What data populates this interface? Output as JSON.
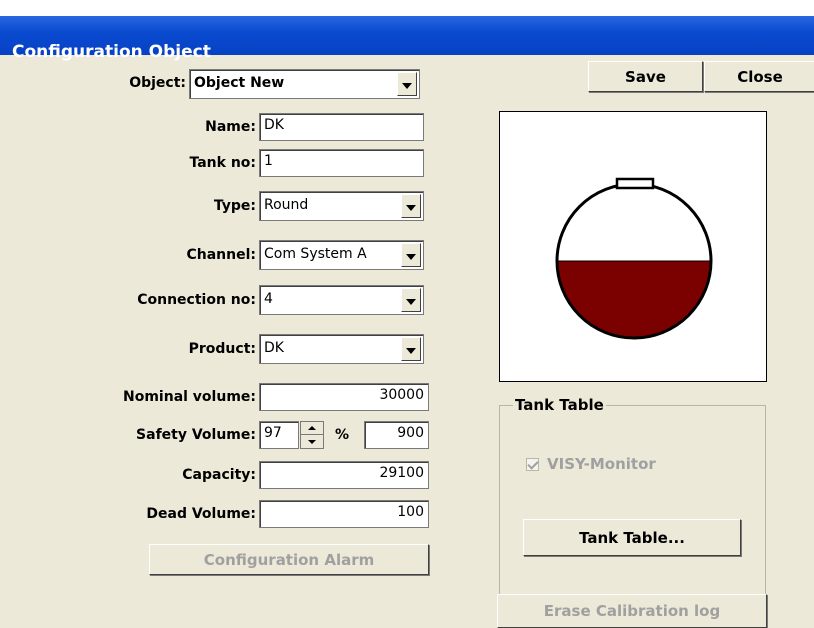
{
  "window": {
    "title": "Configuration Object"
  },
  "toolbar": {
    "save_label": "Save",
    "close_label": "Close"
  },
  "form": {
    "object": {
      "label": "Object:",
      "value": "Object New"
    },
    "name": {
      "label": "Name:",
      "value": "DK"
    },
    "tank_no": {
      "label": "Tank no:",
      "value": "1"
    },
    "type": {
      "label": "Type:",
      "value": "Round"
    },
    "channel": {
      "label": "Channel:",
      "value": "Com System A"
    },
    "connection_no": {
      "label": "Connection no:",
      "value": "4"
    },
    "product": {
      "label": "Product:",
      "value": "DK"
    },
    "nominal_volume": {
      "label": "Nominal volume:",
      "value": "30000"
    },
    "safety_volume": {
      "label": "Safety Volume:",
      "percent": "97",
      "unit": "%",
      "value": "900"
    },
    "capacity": {
      "label": "Capacity:",
      "value": "29100"
    },
    "dead_volume": {
      "label": "Dead Volume:",
      "value": "100"
    },
    "config_alarm_label": "Configuration Alarm"
  },
  "tank_preview": {
    "fill_level": 0.5,
    "fill_color": "#7B0000",
    "outline_color": "#000000"
  },
  "tank_table": {
    "group_label": "Tank Table",
    "visy_monitor_label": "VISY-Monitor",
    "visy_monitor_checked": true,
    "tank_table_button_label": "Tank Table...",
    "erase_calibration_label": "Erase Calibration log"
  }
}
